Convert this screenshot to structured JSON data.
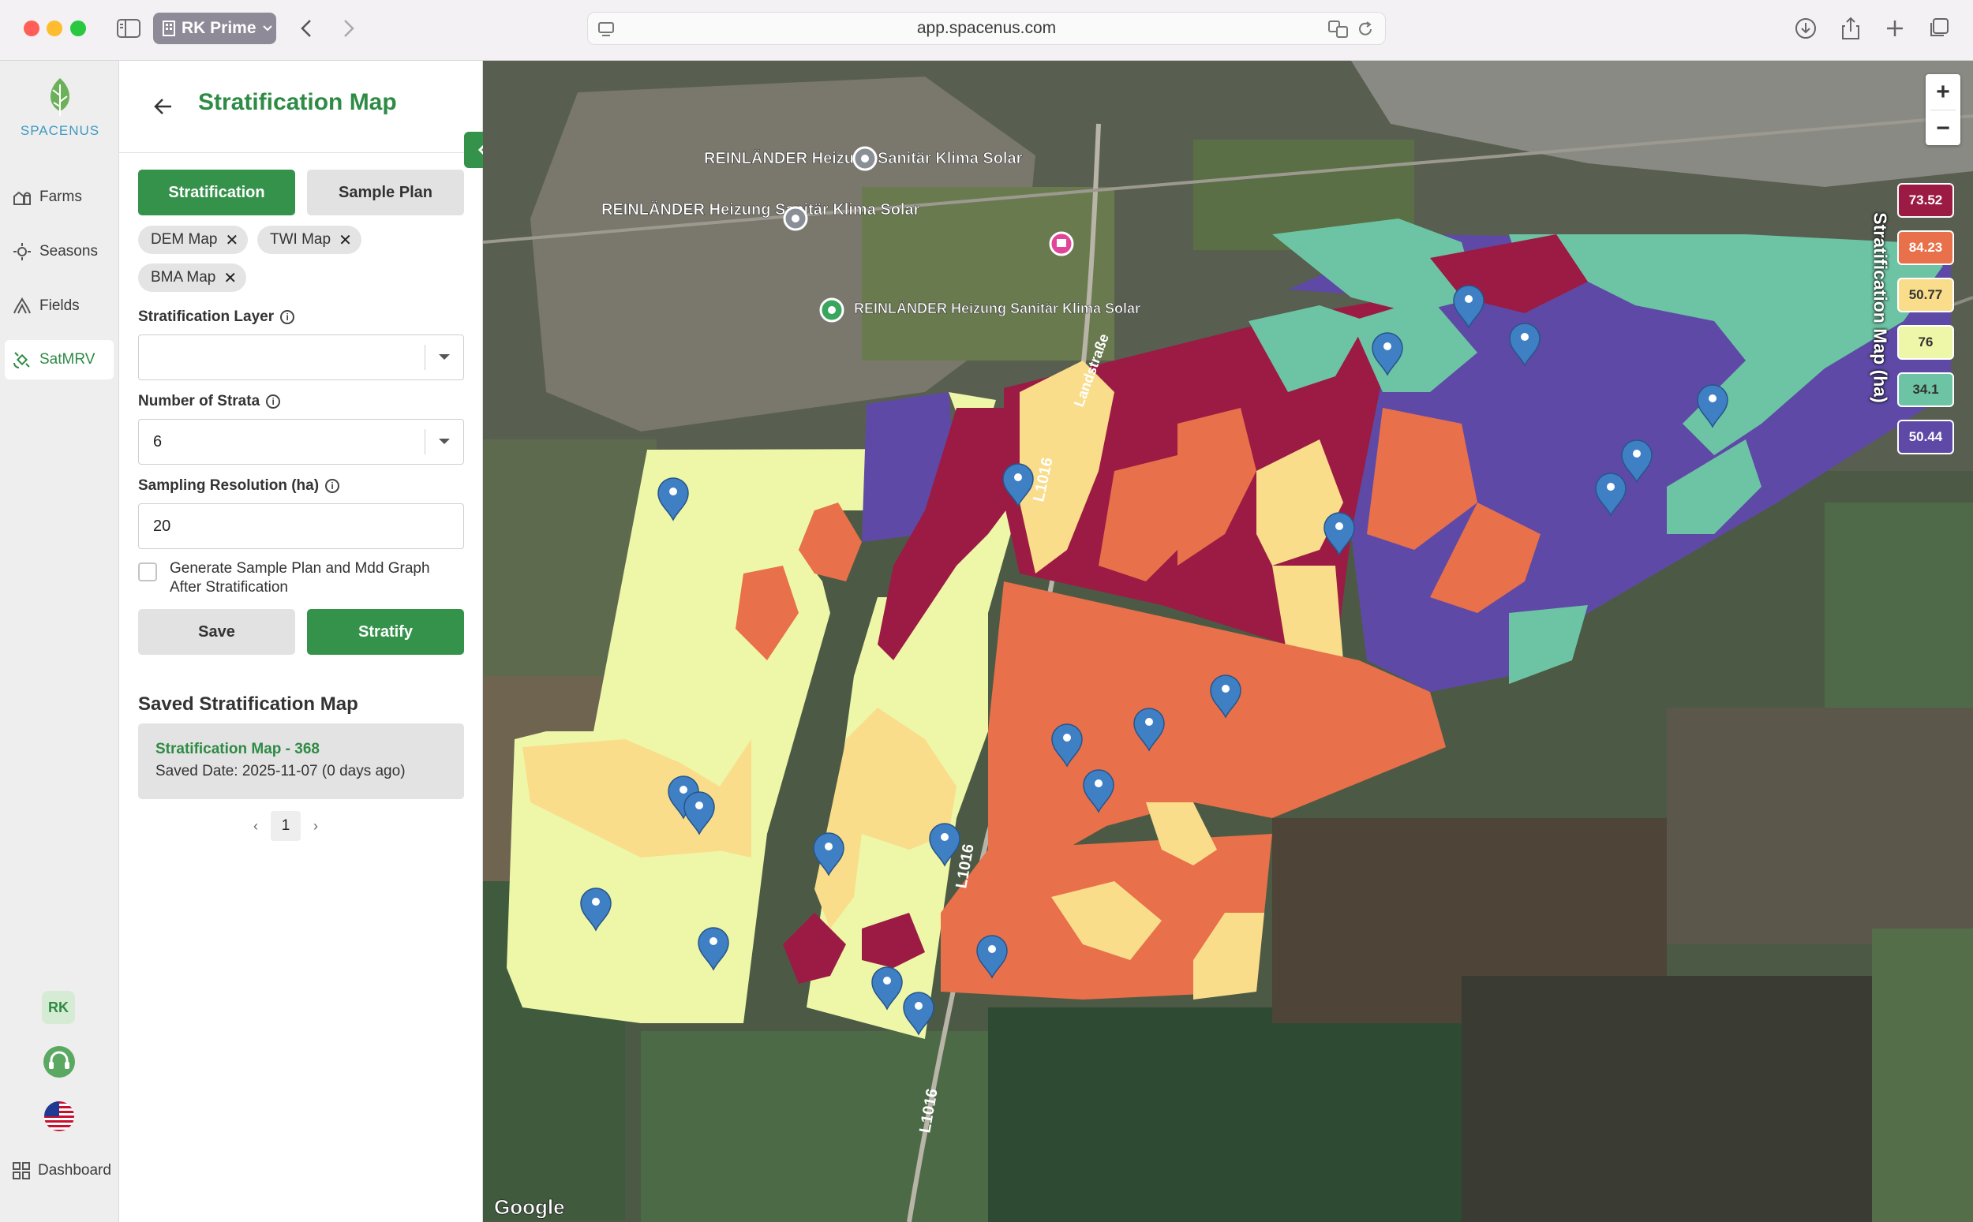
{
  "browser": {
    "profile_label": "RK Prime",
    "url": "app.spacenus.com"
  },
  "rail": {
    "logo_text": "SPACENUS",
    "items": [
      {
        "label": "Farms",
        "icon": "farm-icon"
      },
      {
        "label": "Seasons",
        "icon": "seasons-icon"
      },
      {
        "label": "Fields",
        "icon": "fields-icon"
      },
      {
        "label": "SatMRV",
        "icon": "satellite-icon",
        "active": true
      }
    ],
    "avatar_initials": "RK",
    "dashboard_label": "Dashboard"
  },
  "panel": {
    "title": "Stratification Map",
    "tabs": {
      "stratification": "Stratification",
      "sample_plan": "Sample Plan"
    },
    "chips": [
      "DEM Map",
      "TWI Map",
      "BMA Map"
    ],
    "stratification_layer": {
      "label": "Stratification Layer",
      "value": ""
    },
    "number_of_strata": {
      "label": "Number of Strata",
      "value": "6"
    },
    "sampling_resolution": {
      "label": "Sampling Resolution (ha)",
      "value": "20"
    },
    "generate_checkbox_label": "Generate Sample Plan and Mdd Graph After Stratification",
    "generate_checked": false,
    "save_label": "Save",
    "stratify_label": "Stratify",
    "saved_heading": "Saved Stratification Map",
    "saved_items": [
      {
        "name": "Stratification Map - 368",
        "date": "Saved Date: 2025-11-07 (0 days ago)"
      }
    ],
    "pagination": {
      "current": "1"
    }
  },
  "map": {
    "legend_title": "Stratification Map (ha)",
    "legend": [
      {
        "value": "73.52",
        "color": "#9b1b44",
        "text_color": "#ffffff"
      },
      {
        "value": "84.23",
        "color": "#e8704a",
        "text_color": "#ffffff"
      },
      {
        "value": "50.77",
        "color": "#f9dd8a",
        "text_color": "#333333"
      },
      {
        "value": "76",
        "color": "#eef7a8",
        "text_color": "#333333"
      },
      {
        "value": "34.1",
        "color": "#6dc4a4",
        "text_color": "#333333"
      },
      {
        "value": "50.44",
        "color": "#5e4aa6",
        "text_color": "#ffffff"
      }
    ],
    "road_labels": [
      "L1016",
      "L1016",
      "L1016",
      "Landstraße"
    ],
    "place_labels": [
      "REINLÄNDER Heizung Sanitär Klima Solar",
      "REINLÄNDER Heizung Sanitär Klima Solar",
      "REINLÄNDER Heizung Sanitär Klima Solar"
    ],
    "attribution": "Google",
    "zoom_in": "+",
    "zoom_out": "−"
  }
}
